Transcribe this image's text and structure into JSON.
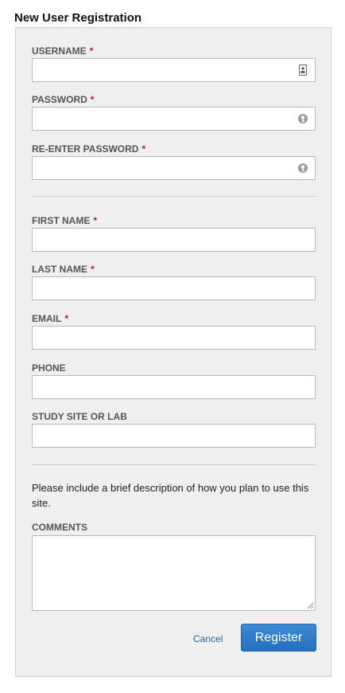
{
  "page": {
    "title": "New User Registration"
  },
  "form": {
    "required_marker": "*",
    "fields": {
      "username": {
        "label": "USERNAME",
        "value": "",
        "icon": "contact-card-icon"
      },
      "password": {
        "label": "PASSWORD",
        "value": "",
        "icon": "key-icon"
      },
      "reenter_password": {
        "label": "RE-ENTER PASSWORD",
        "value": "",
        "icon": "key-icon"
      },
      "first_name": {
        "label": "FIRST NAME",
        "value": ""
      },
      "last_name": {
        "label": "LAST NAME",
        "value": ""
      },
      "email": {
        "label": "EMAIL",
        "value": ""
      },
      "phone": {
        "label": "PHONE",
        "value": ""
      },
      "study_site": {
        "label": "STUDY SITE OR LAB",
        "value": ""
      },
      "comments": {
        "label": "COMMENTS",
        "value": ""
      }
    },
    "instructions": "Please include a brief description of how you plan to use this site.",
    "cancel_label": "Cancel",
    "register_label": "Register"
  },
  "colors": {
    "panel_background": "#efefef",
    "required": "#c0192b",
    "link": "#2a5db0",
    "primary_button": "#2670bf"
  }
}
